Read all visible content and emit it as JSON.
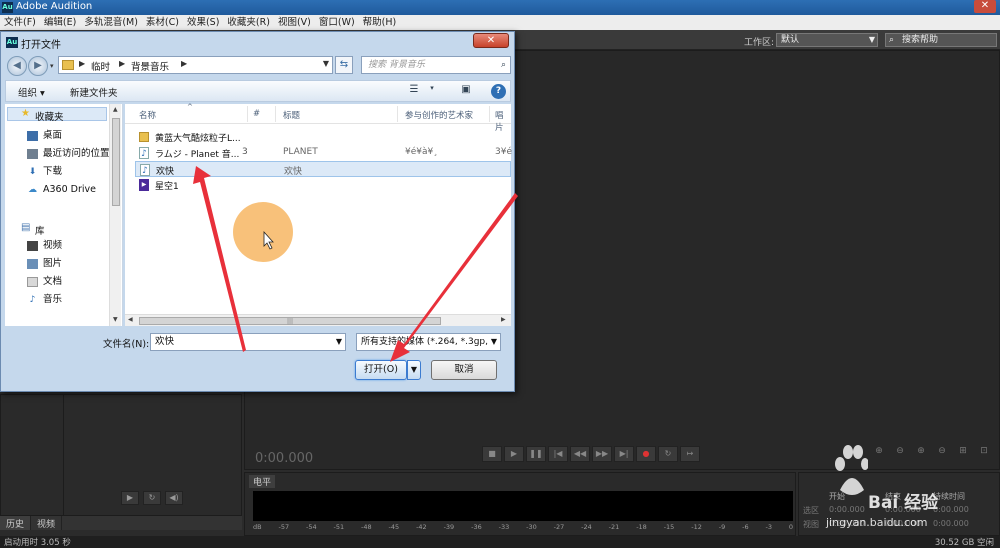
{
  "app": {
    "title": "Adobe Audition",
    "icon_text": "Au",
    "menu": [
      "文件(F)",
      "编辑(E)",
      "多轨混音(M)",
      "素材(C)",
      "效果(S)",
      "收藏夹(R)",
      "视图(V)",
      "窗口(W)",
      "帮助(H)"
    ],
    "workspace_label": "工作区:",
    "workspace_value": "默认",
    "help_search": "搜索帮助"
  },
  "editor": {
    "time": "0:00.000"
  },
  "panels": {
    "history_tab": "历史",
    "video_tab": "视频",
    "meter_tab": "电平",
    "meter_scale": [
      "dB",
      "-57",
      "-54",
      "-51",
      "-48",
      "-45",
      "-42",
      "-39",
      "-36",
      "-33",
      "-30",
      "-27",
      "-24",
      "-21",
      "-18",
      "-15",
      "-12",
      "-9",
      "-6",
      "-3",
      "0"
    ],
    "selection": {
      "col_start": "开始",
      "col_end": "结束",
      "col_duration": "持续时间",
      "row1": "选区",
      "row2": "视图",
      "zero": "0:00.000"
    }
  },
  "status": {
    "left": "启动用时 3.05 秒",
    "right": "30.52 GB 空闲"
  },
  "dialog": {
    "title": "打开文件",
    "icon_text": "Au",
    "breadcrumb": [
      "临时",
      "背景音乐"
    ],
    "search_placeholder": "搜索 背景音乐",
    "organize": "组织 ▾",
    "new_folder": "新建文件夹",
    "nav": {
      "favorites": "收藏夹",
      "desktop": "桌面",
      "recent": "最近访问的位置",
      "downloads": "下载",
      "a360": "A360 Drive",
      "libraries": "库",
      "videos": "视频",
      "pictures": "图片",
      "documents": "文档",
      "music": "音乐"
    },
    "columns": {
      "name": "名称",
      "num": "#",
      "title": "标题",
      "artist": "参与创作的艺术家",
      "album": "唱片"
    },
    "files": [
      {
        "name": "黄蓝大气酷炫粒子L...",
        "num": "",
        "title": "",
        "artist": "",
        "album": "",
        "icon": "folder-icon"
      },
      {
        "name": "ラムジ - Planet 音...",
        "num": "3",
        "title": "PLANET",
        "artist": "¥é¥à¥¸",
        "album": "3¥é",
        "icon": "music-file-icon"
      },
      {
        "name": "欢快",
        "num": "",
        "title": "欢快",
        "artist": "",
        "album": "",
        "icon": "music-file-icon"
      },
      {
        "name": "星空1",
        "num": "",
        "title": "",
        "artist": "",
        "album": "",
        "icon": "video-file-icon"
      }
    ],
    "filename_label": "文件名(N):",
    "filename_value": "欢快",
    "filter_value": "所有支持的媒体 (*.264, *.3gp,",
    "open_label": "打开(O)",
    "cancel_label": "取消"
  },
  "watermark": {
    "brand": "Bai 经验",
    "url": "jingyan.baidu.com"
  },
  "colors": {
    "annotation_arrow": "#e8303a",
    "cursor_highlight": "#f6af54",
    "selection": "#dce9f7"
  }
}
